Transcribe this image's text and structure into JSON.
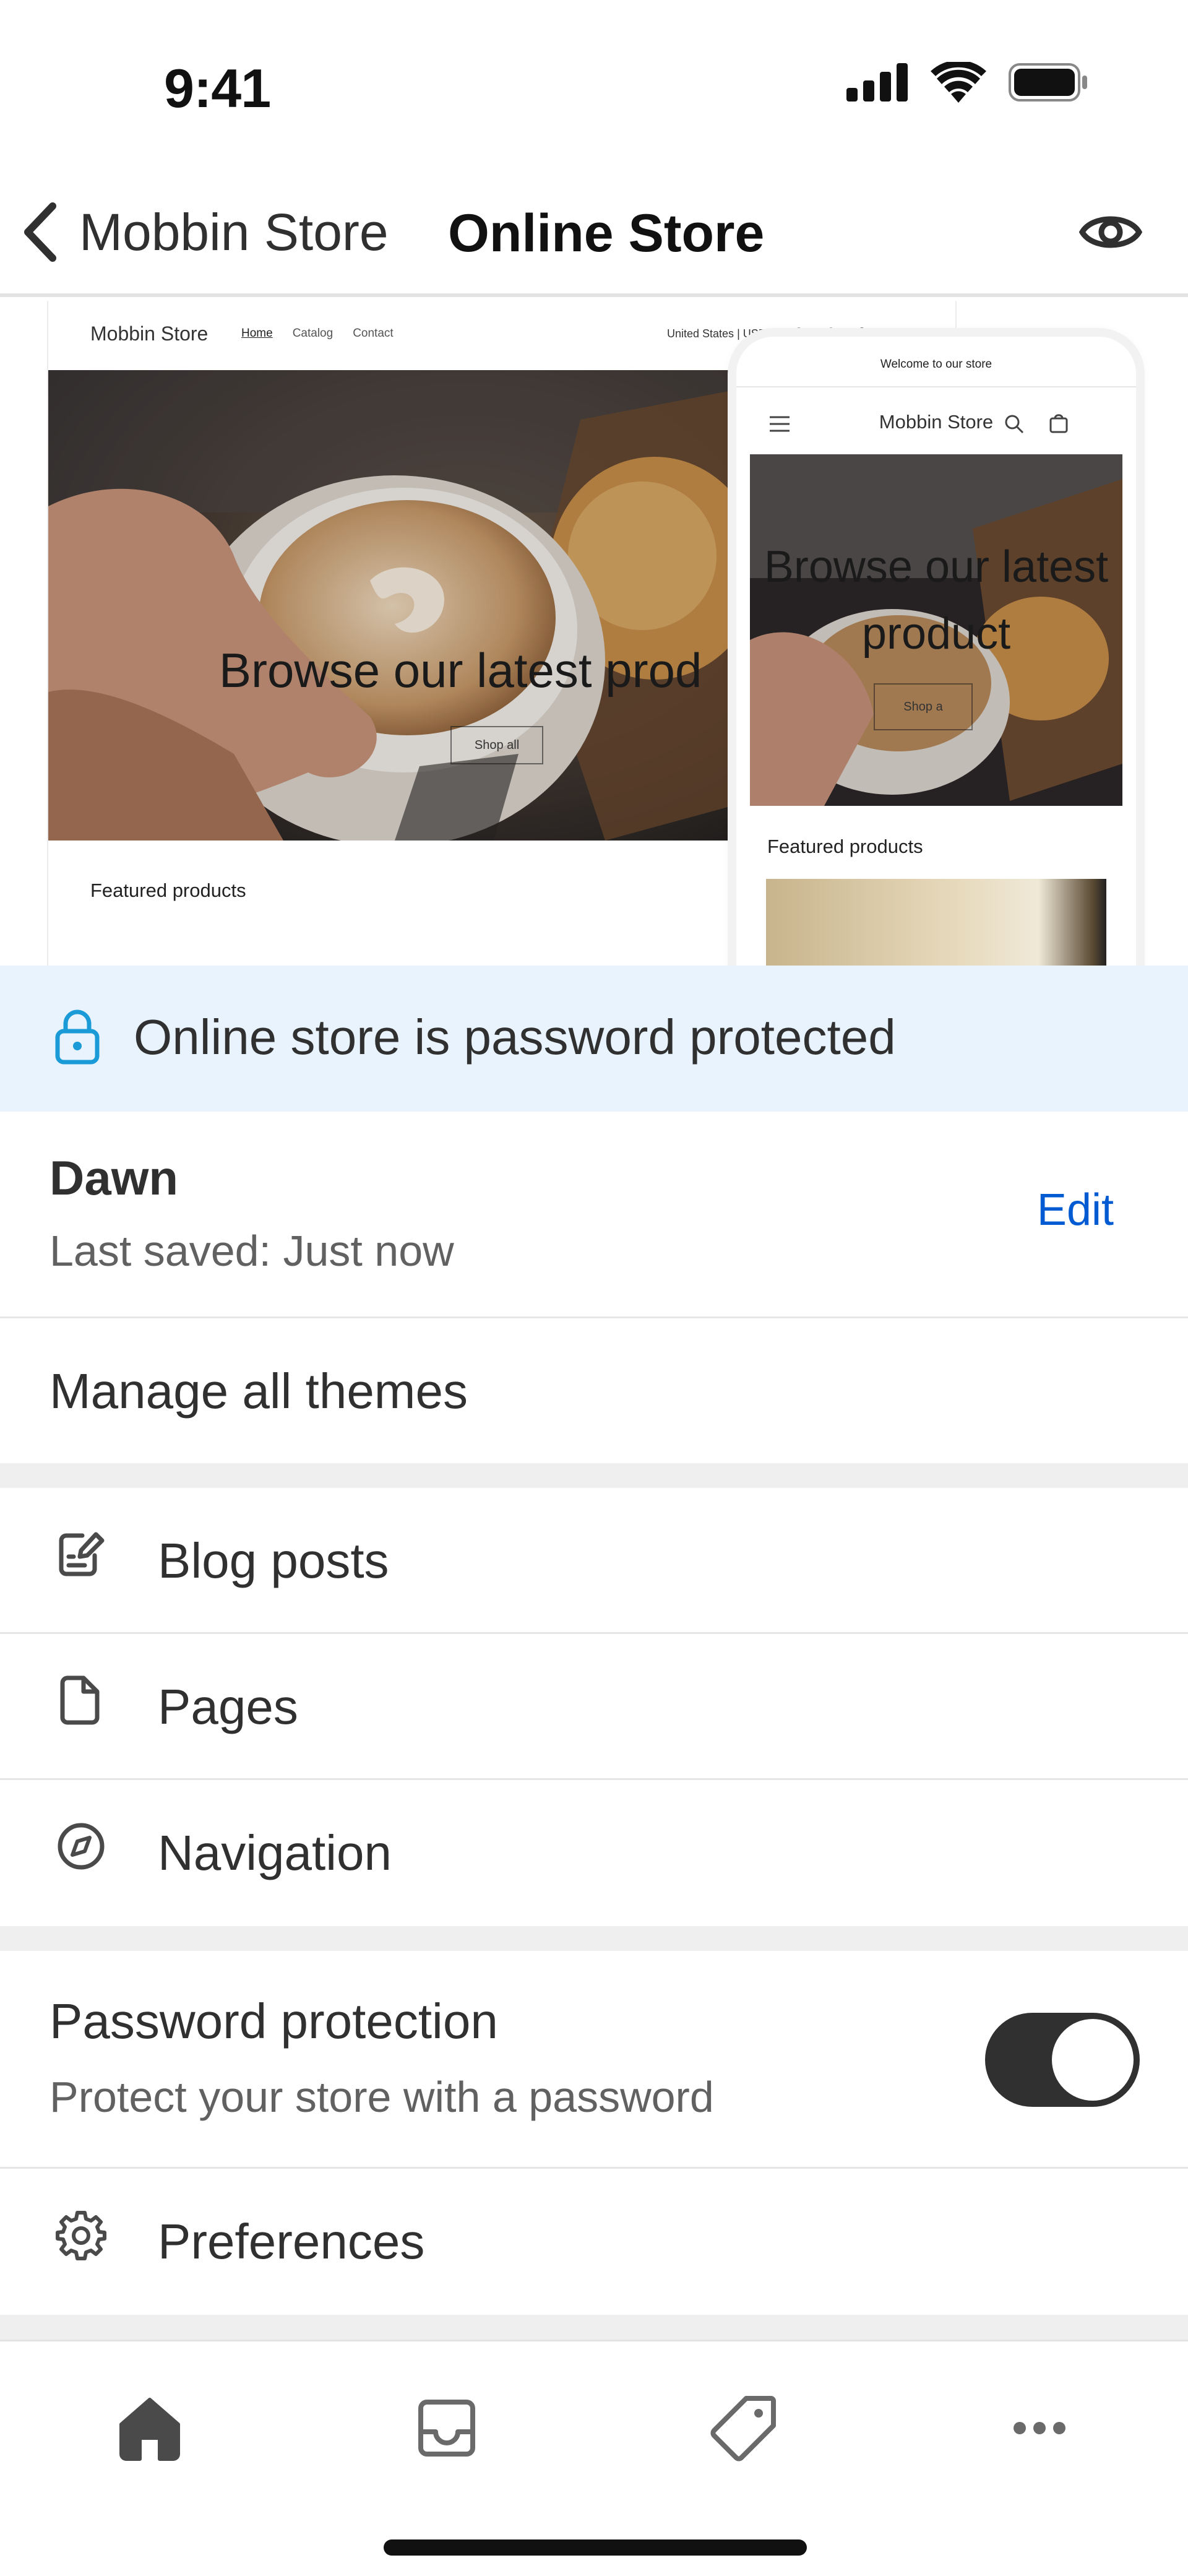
{
  "status_bar": {
    "time": "9:41"
  },
  "header": {
    "back_label": "Mobbin Store",
    "title": "Online Store"
  },
  "preview": {
    "desktop": {
      "store_name": "Mobbin Store",
      "nav_links": [
        "Home",
        "Catalog",
        "Contact"
      ],
      "locale": "United States | USD $",
      "hero_text": "Browse our latest prod",
      "hero_button": "Shop all",
      "featured": "Featured products"
    },
    "mobile": {
      "announcement": "Welcome to our store",
      "store_name": "Mobbin Store",
      "hero_text": "Browse our latest product",
      "hero_button": "Shop a",
      "featured": "Featured products"
    }
  },
  "banner": {
    "text": "Online store is password protected",
    "accent": "#1a9bd7",
    "background": "#e8f3fe"
  },
  "theme": {
    "name": "Dawn",
    "saved": "Last saved: Just now",
    "edit_label": "Edit"
  },
  "manage_themes": "Manage all themes",
  "menu": [
    {
      "label": "Blog posts",
      "icon": "compose-icon"
    },
    {
      "label": "Pages",
      "icon": "page-icon"
    },
    {
      "label": "Navigation",
      "icon": "compass-icon"
    }
  ],
  "password_protection": {
    "title": "Password protection",
    "subtitle": "Protect your store with a password",
    "enabled": true
  },
  "preferences": {
    "label": "Preferences",
    "icon": "gear-icon"
  },
  "tabbar": {
    "tabs": [
      "home-icon",
      "inbox-icon",
      "tag-icon",
      "more-icon"
    ],
    "active": "home-icon"
  }
}
